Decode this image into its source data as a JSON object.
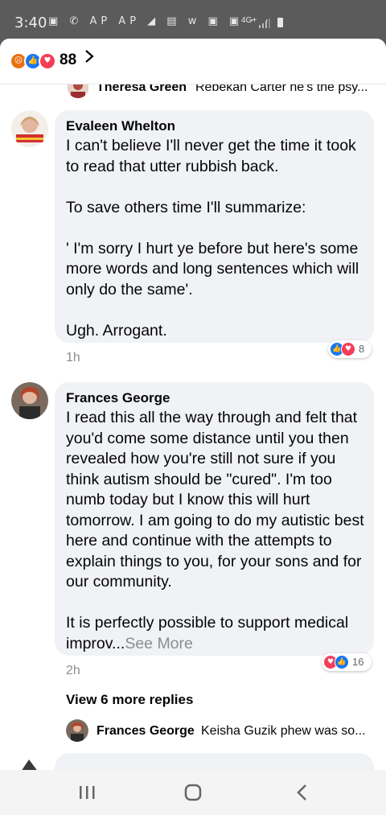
{
  "status_bar": {
    "time": "3:40",
    "icons": "▣ ✆ AP AP ◢ ▤ w ▣ ▣ · ·",
    "network": "4G+"
  },
  "header": {
    "reaction_count": "88"
  },
  "comments": [
    {
      "author": "Theresa Green",
      "preview": "Rebekah Carter he's the psy..."
    },
    {
      "author": "Evaleen Whelton",
      "text": "I can't believe I'll never get the time it took to read that utter rubbish back.\n\nTo save others time I'll summarize:\n\n' I'm sorry I hurt ye before but here's some more words and long sentences which will only do the same'.\n\nUgh. Arrogant.",
      "time": "1h",
      "reaction_count": "8"
    },
    {
      "author": "Frances George",
      "text": "I read this all the way through and felt that you'd come some distance until you then revealed how you're still not sure if you think autism should be \"cured\".  I'm too numb today but I know this will hurt tomorrow. I am going to do my autistic best here and continue with the attempts to explain things to you, for your sons and for our community.\n\nIt is perfectly possible to support medical improv...",
      "see_more": "See More",
      "time": "2h",
      "reaction_count": "16"
    }
  ],
  "view_more_replies": "View 6 more replies",
  "reply_preview": {
    "author": "Frances George",
    "preview": "Keisha Guzik phew was so..."
  },
  "colors": {
    "like_blue": "#1877f2",
    "love_red": "#f33e58",
    "angry_orange": "#e9710f",
    "bubble_gray": "#f0f2f5",
    "meta_gray": "#8a8d91"
  }
}
